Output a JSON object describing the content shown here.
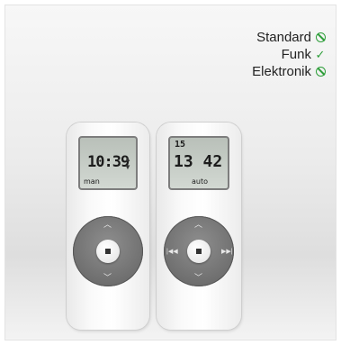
{
  "legend": [
    {
      "label": "Standard",
      "status": "not-available"
    },
    {
      "label": "Funk",
      "status": "available"
    },
    {
      "label": "Elektronik",
      "status": "not-available"
    }
  ],
  "remote_left": {
    "time": "10:39",
    "mode": "man",
    "arrows": [
      "▲",
      "▼"
    ]
  },
  "remote_right": {
    "day": "15",
    "time": "13 42",
    "mode": "auto"
  },
  "colors": {
    "accent_green": "#2e9e3a",
    "lcd": "#c6ccc6",
    "wheel": "#767676"
  }
}
